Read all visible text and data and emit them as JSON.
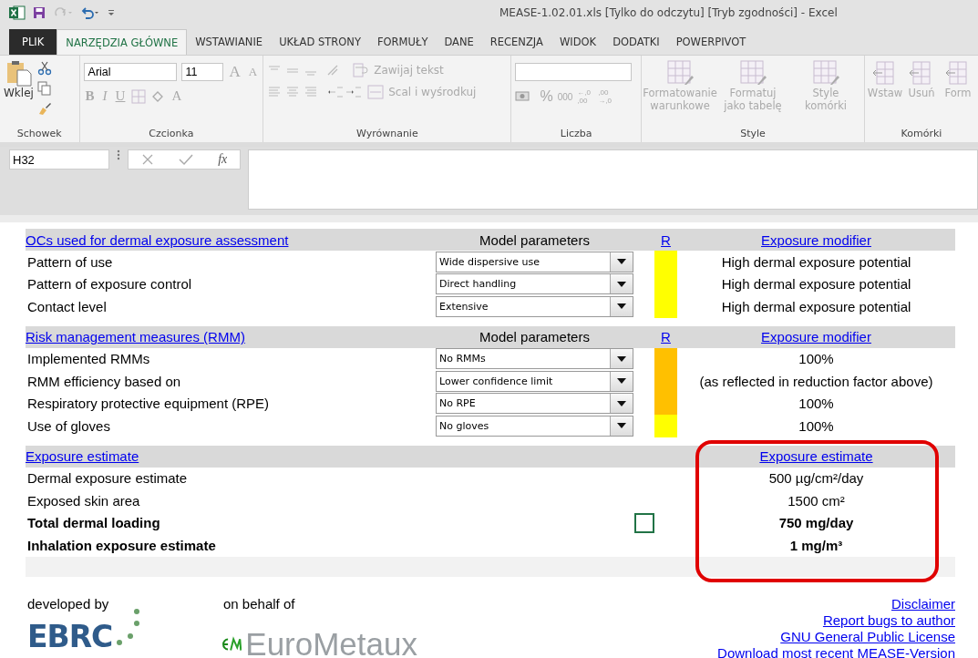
{
  "window": {
    "title": "MEASE-1.02.01.xls  [Tylko do odczytu]  [Tryb zgodności] - Excel"
  },
  "ribbon_tabs": [
    {
      "label": "PLIK",
      "kind": "file",
      "selected": false
    },
    {
      "label": "NARZĘDZIA GŁÓWNE",
      "kind": "tab",
      "selected": true
    },
    {
      "label": "WSTAWIANIE",
      "kind": "tab",
      "selected": false
    },
    {
      "label": "UKŁAD STRONY",
      "kind": "tab",
      "selected": false
    },
    {
      "label": "FORMUŁY",
      "kind": "tab",
      "selected": false
    },
    {
      "label": "DANE",
      "kind": "tab",
      "selected": false
    },
    {
      "label": "RECENZJA",
      "kind": "tab",
      "selected": false
    },
    {
      "label": "WIDOK",
      "kind": "tab",
      "selected": false
    },
    {
      "label": "DODATKI",
      "kind": "tab",
      "selected": false
    },
    {
      "label": "POWERPIVOT",
      "kind": "tab",
      "selected": false
    }
  ],
  "ribbon": {
    "clipboard": {
      "paste": "Wklej",
      "group": "Schowek"
    },
    "font": {
      "name": "Arial",
      "size": "11",
      "grow": "A",
      "shrink": "A",
      "bold": "B",
      "italic": "I",
      "underline": "U",
      "font_color": "A",
      "group": "Czcionka"
    },
    "alignment": {
      "wrap": "Zawijaj tekst",
      "merge": "Scal i wyśrodkuj",
      "group": "Wyrównanie"
    },
    "number": {
      "percent": "%",
      "thousands": "000",
      "inc_decimal": "←,0 ,00",
      "dec_decimal": ",00 →,0",
      "group": "Liczba"
    },
    "styles": {
      "commands": [
        {
          "line1": "Formatowanie",
          "line2": "warunkowe"
        },
        {
          "line1": "Formatuj",
          "line2": "jako tabelę"
        },
        {
          "line1": "Style",
          "line2": "komórki"
        }
      ],
      "group": "Style"
    },
    "cells": {
      "commands": [
        "Wstaw",
        "Usuń",
        "Form"
      ],
      "group": "Komórki"
    }
  },
  "formula_bar": {
    "name_box": "H32",
    "fx": "fx"
  },
  "sections": [
    {
      "kind": "parameters",
      "title": "OCs used for dermal exposure assessment",
      "params_heading": "Model parameters",
      "r_heading": "R",
      "modifier_heading": "Exposure modifier",
      "rows": [
        {
          "label": "Pattern of use",
          "value": "Wide dispersive use",
          "color": "#ffff00",
          "modifier": "High dermal exposure potential"
        },
        {
          "label": "Pattern of exposure control",
          "value": "Direct handling",
          "color": "#ffff00",
          "modifier": "High dermal exposure potential"
        },
        {
          "label": "Contact level",
          "value": "Extensive",
          "color": "#ffff00",
          "modifier": "High dermal exposure potential"
        }
      ]
    },
    {
      "kind": "parameters",
      "title": "Risk management measures (RMM)",
      "params_heading": "Model parameters",
      "r_heading": "R",
      "modifier_heading": "Exposure modifier",
      "rows": [
        {
          "label": "Implemented RMMs",
          "value": "No RMMs",
          "color": "#ffc000",
          "modifier": "100%"
        },
        {
          "label": "RMM efficiency based on",
          "value": "Lower confidence limit",
          "color": "#ffc000",
          "modifier": "(as reflected in reduction factor above)"
        },
        {
          "label": "Respiratory protective equipment (RPE)",
          "value": "No RPE",
          "color": "#ffc000",
          "modifier": "100%"
        },
        {
          "label": "Use of gloves",
          "value": "No gloves",
          "color": "#ffff00",
          "modifier": "100%"
        }
      ]
    },
    {
      "kind": "estimate",
      "title": "Exposure estimate",
      "estimate_heading": "Exposure estimate",
      "rows": [
        {
          "label": "Dermal exposure estimate",
          "value": "500 µg/cm²/day",
          "bold": false,
          "selected": false
        },
        {
          "label": "Exposed skin area",
          "value": "1500 cm²",
          "bold": false,
          "selected": false
        },
        {
          "label": "Total dermal loading",
          "value": "750 mg/day",
          "bold": true,
          "selected": true
        },
        {
          "label": "Inhalation exposure estimate",
          "value": "1 mg/m³",
          "bold": true,
          "selected": false
        }
      ]
    }
  ],
  "footer": {
    "developed_by": "developed by",
    "developer_logo": "EBRC",
    "on_behalf_of": "on behalf of",
    "sponsor_logo": "EuroMetaux",
    "links": [
      "Disclaimer",
      "Report bugs to author",
      "GNU General Public License",
      "Download most recent MEASE-Version"
    ]
  }
}
